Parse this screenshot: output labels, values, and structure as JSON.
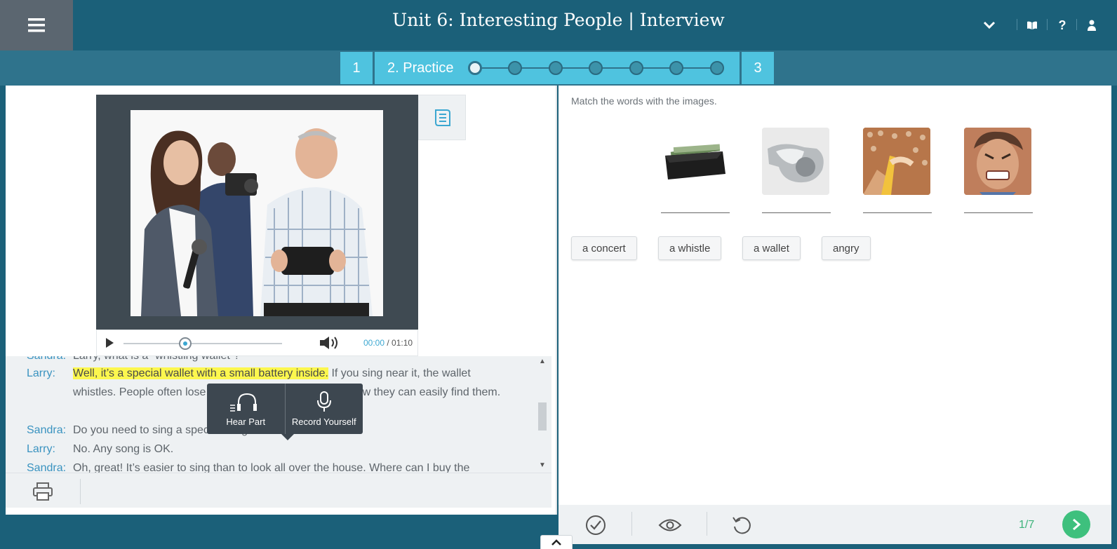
{
  "header": {
    "title": "Unit 6: Interesting People | Interview",
    "icons": [
      "menu-icon",
      "chevron-down-icon",
      "book-icon",
      "help-icon",
      "user-icon"
    ]
  },
  "stepper": {
    "step1_label": "1",
    "active_label": "2. Practice",
    "step3_label": "3",
    "dots": 7,
    "current_dot": 1
  },
  "player": {
    "current_time": "00:00",
    "separator": " / ",
    "duration": "01:10",
    "progress_fraction": 0.4
  },
  "transcript": {
    "lines": [
      {
        "speaker": "Sandra:",
        "text": "Larry, what is a “whistling wallet”?"
      },
      {
        "speaker": "Larry:",
        "highlight": "Well, it’s a special wallet with a small battery inside.",
        "text": " If you sing near it, the wallet whistles. People often lose their wallets in their homes. Now they can easily find them."
      },
      {
        "speaker": "Sandra:",
        "text": "Do you need to sing a special song?"
      },
      {
        "speaker": "Larry:",
        "text": "No. Any song is OK."
      },
      {
        "speaker": "Sandra:",
        "text": "Oh, great! It’s easier to sing than to look all over the house. Where can I buy the"
      }
    ]
  },
  "popup": {
    "hear_part": "Hear Part",
    "record_yourself": "Record Yourself"
  },
  "exercise": {
    "instruction": "Match the words with the images.",
    "images": [
      "wallet",
      "whistle",
      "concert",
      "angry face"
    ],
    "words": [
      "a concert",
      "a whistle",
      "a wallet",
      "angry"
    ]
  },
  "footer": {
    "page": "1/7"
  },
  "colors": {
    "header_bg": "#1b6079",
    "step_accent": "#4fc3df",
    "speaker": "#3a93c0",
    "highlight": "#fcf74e",
    "next": "#3ec07d"
  }
}
